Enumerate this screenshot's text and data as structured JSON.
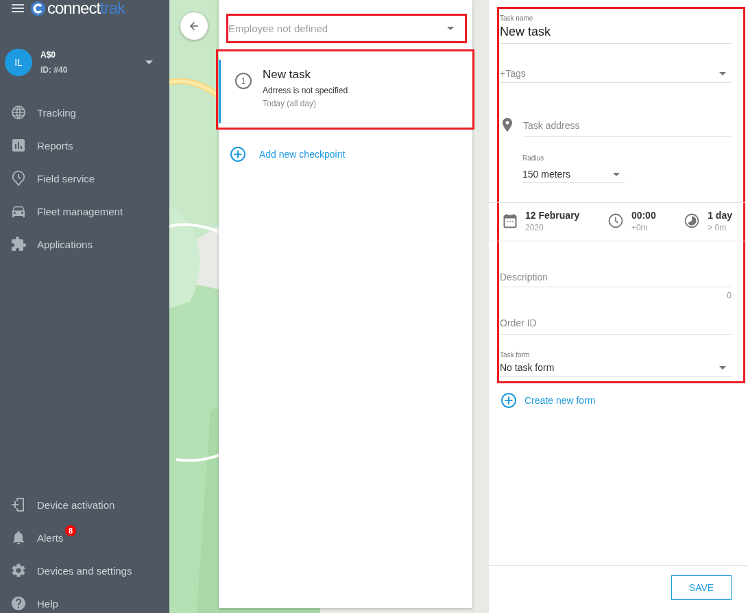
{
  "logo": {
    "text": "connect",
    "accent": "trak"
  },
  "account": {
    "initials": "IL",
    "name": "A$0",
    "id": "ID: #40"
  },
  "nav": [
    {
      "label": "Tracking",
      "kind": "globe"
    },
    {
      "label": "Reports",
      "kind": "chart"
    },
    {
      "label": "Field service",
      "kind": "clockpin"
    },
    {
      "label": "Fleet management",
      "kind": "car"
    },
    {
      "label": "Applications",
      "kind": "puzzle"
    }
  ],
  "nav_bottom": [
    {
      "label": "Device activation",
      "kind": "device"
    },
    {
      "label": "Alerts",
      "kind": "bell",
      "badge": "8"
    },
    {
      "label": "Devices and settings",
      "kind": "gear"
    },
    {
      "label": "Help",
      "kind": "help"
    }
  ],
  "employee_select": {
    "placeholder": "Employee not defined",
    "highlighted": true
  },
  "checkpoints_highlighted": true,
  "checkpoints": [
    {
      "number": "1",
      "title": "New task",
      "address": "Adrress is not specified",
      "time": "Today (all day)",
      "selected": true
    }
  ],
  "add_checkpoint": "Add new checkpoint",
  "task": {
    "highlighted": true,
    "task_name": {
      "label": "Task name",
      "value": "New task"
    },
    "tags": {
      "placeholder": "+Tags"
    },
    "address": {
      "placeholder": "Task address"
    },
    "radius": {
      "label": "Radius",
      "value": "150 meters"
    },
    "schedule": [
      {
        "kind": "date",
        "main": "12 February",
        "sub": "2020"
      },
      {
        "kind": "time",
        "main": "00:00",
        "sub": "+0m"
      },
      {
        "kind": "duration",
        "main": "1 day",
        "sub": "> 0m"
      }
    ],
    "description": {
      "placeholder": "Description",
      "counter": "0"
    },
    "order_id": {
      "placeholder": "Order ID"
    },
    "task_form": {
      "label": "Task form",
      "value": "No task form"
    }
  },
  "create_form": "Create new form",
  "save": "SAVE"
}
